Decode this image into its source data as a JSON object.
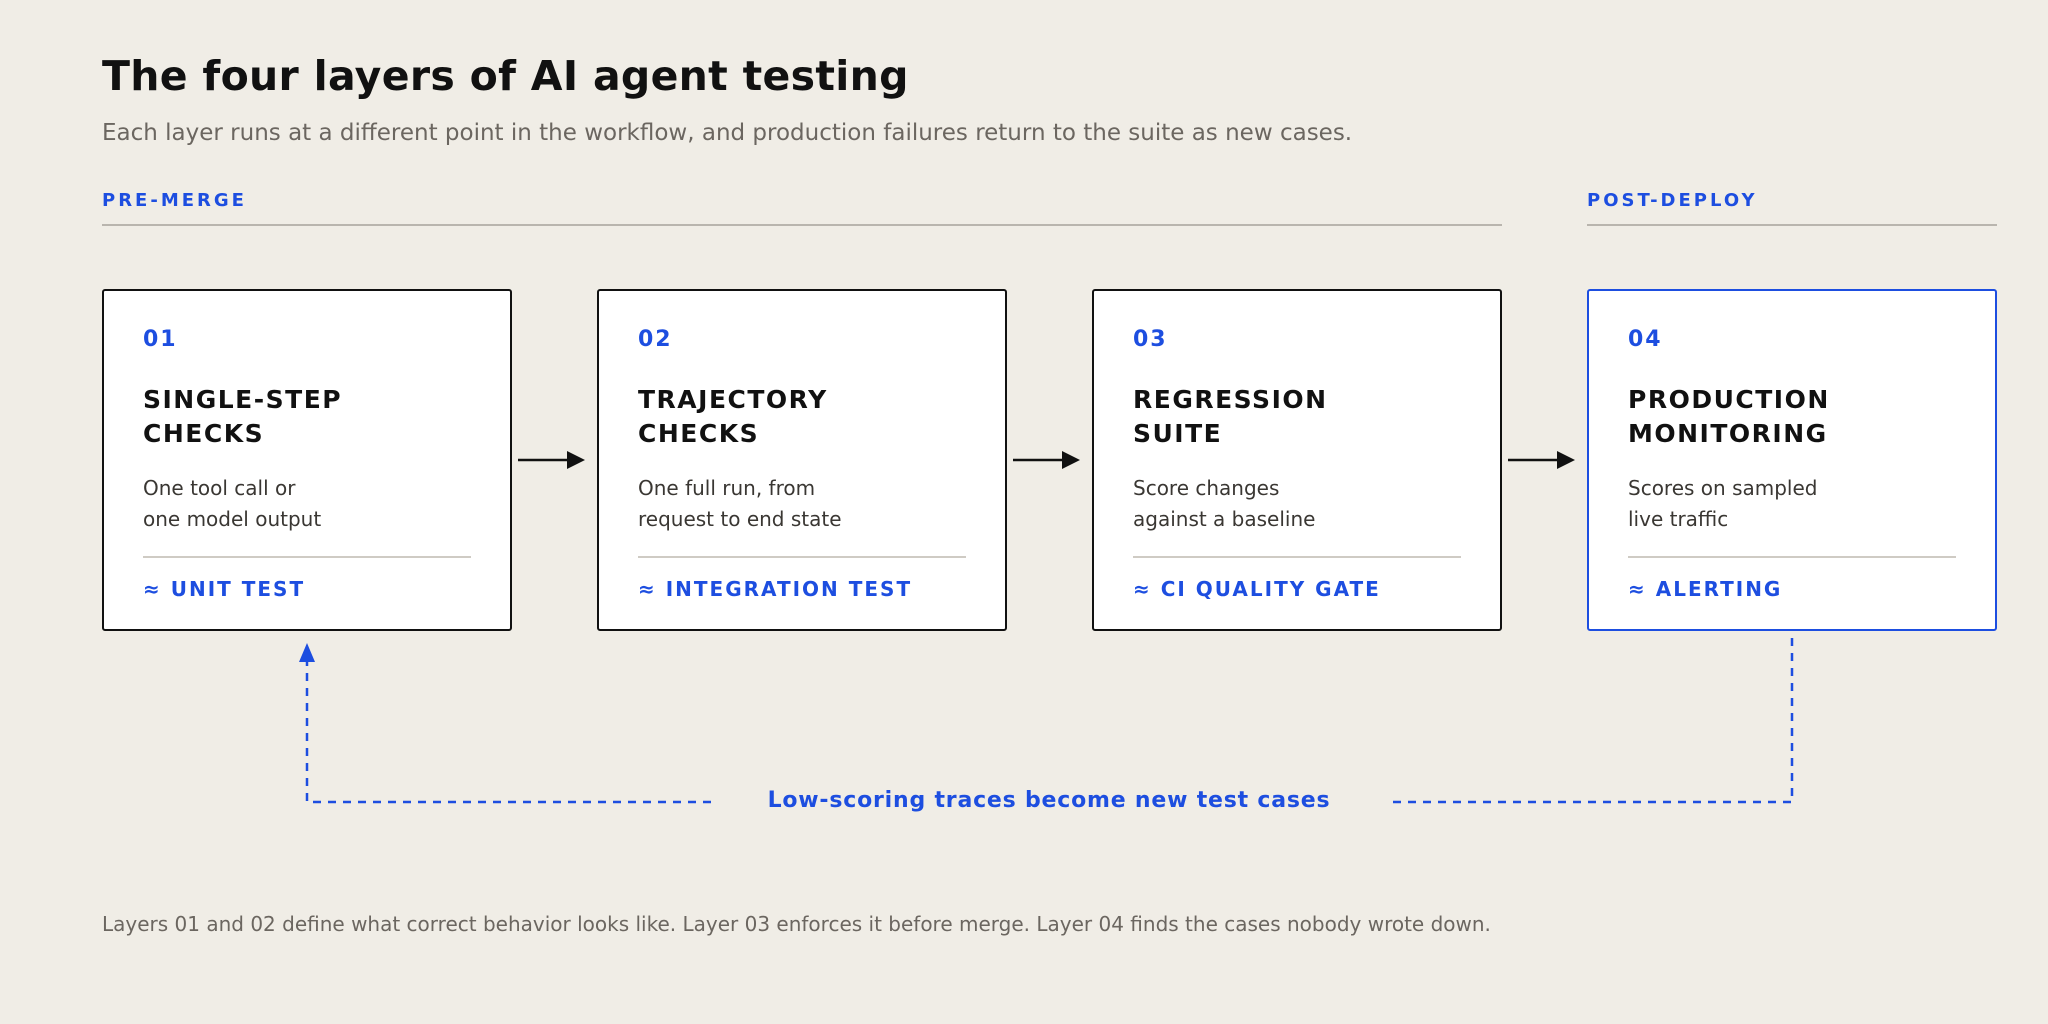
{
  "header": {
    "title": "The four layers of AI agent testing",
    "subtitle": "Each layer runs at a different point in the workflow, and production failures return to the suite as new cases."
  },
  "phases": [
    {
      "label": "PRE-MERGE"
    },
    {
      "label": "POST-DEPLOY"
    }
  ],
  "cards": [
    {
      "number": "01",
      "name": "SINGLE-STEP\nCHECKS",
      "description": "One tool call or\none model output",
      "analogy": "≈ UNIT TEST"
    },
    {
      "number": "02",
      "name": "TRAJECTORY\nCHECKS",
      "description": "One full run, from\nrequest to end state",
      "analogy": "≈ INTEGRATION TEST"
    },
    {
      "number": "03",
      "name": "REGRESSION\nSUITE",
      "description": "Score changes\nagainst a baseline",
      "analogy": "≈ CI QUALITY GATE"
    },
    {
      "number": "04",
      "name": "PRODUCTION\nMONITORING",
      "description": "Scores on sampled\nlive traffic",
      "analogy": "≈ ALERTING"
    }
  ],
  "feedback_loop": {
    "label": "Low-scoring traces become new test cases"
  },
  "footnote": "Layers 01 and 02 define what correct behavior looks like. Layer 03 enforces it before merge. Layer 04 finds the cases nobody wrote down.",
  "colors": {
    "accent": "#1d4ee0",
    "ink": "#111111",
    "background": "#f0ede6",
    "muted": "#6b6660"
  }
}
